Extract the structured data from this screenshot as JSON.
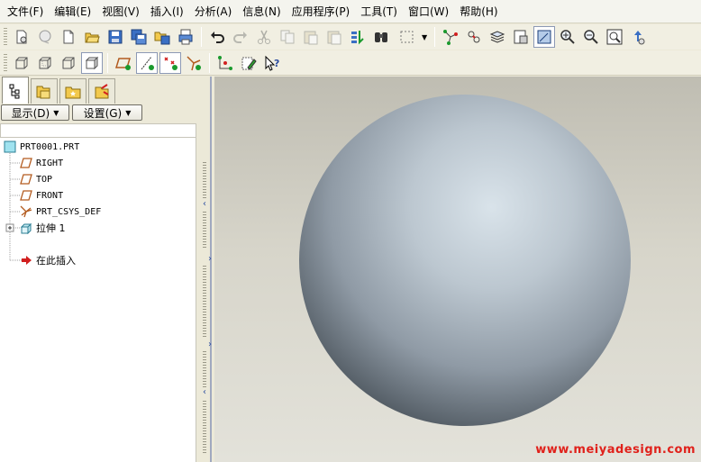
{
  "menu": {
    "file": "文件(F)",
    "edit": "编辑(E)",
    "view": "视图(V)",
    "insert": "插入(I)",
    "analysis": "分析(A)",
    "info": "信息(N)",
    "applications": "应用程序(P)",
    "tools": "工具(T)",
    "window": "窗口(W)",
    "help": "帮助(H)"
  },
  "panel": {
    "show_button": "显示(D)",
    "settings_button": "设置(G)"
  },
  "tree": {
    "root": "PRT0001.PRT",
    "items": [
      "RIGHT",
      "TOP",
      "FRONT",
      "PRT_CSYS_DEF",
      "拉伸 1",
      "在此插入"
    ]
  },
  "watermark": "www.meiyadesign.com",
  "icons": {
    "tree_plane": "datum-plane-icon",
    "tree_csys": "coordinate-system-icon",
    "tree_extrude": "extrude-feature-icon",
    "tree_insert": "insert-here-arrow-icon"
  },
  "colors": {
    "viewport_bg": "#d7d5ca",
    "sphere": "#a9b6c0",
    "insert_arrow": "#d21f1f",
    "watermark": "#e0211b"
  }
}
